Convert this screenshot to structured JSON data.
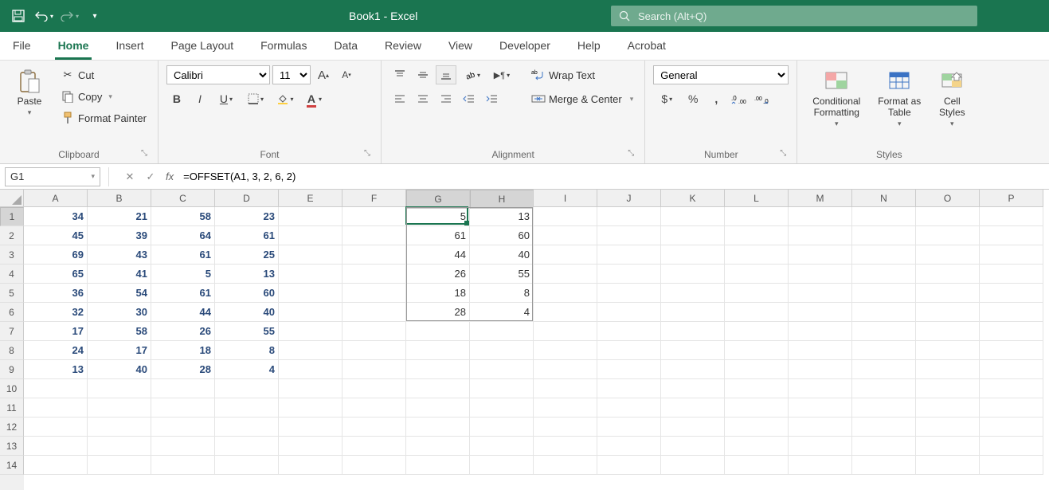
{
  "title": "Book1 - Excel",
  "search": {
    "placeholder": "Search (Alt+Q)"
  },
  "tabs": [
    "File",
    "Home",
    "Insert",
    "Page Layout",
    "Formulas",
    "Data",
    "Review",
    "View",
    "Developer",
    "Help",
    "Acrobat"
  ],
  "activeTab": "Home",
  "ribbon": {
    "clipboard": {
      "paste": "Paste",
      "cut": "Cut",
      "copy": "Copy",
      "fpainter": "Format Painter",
      "label": "Clipboard"
    },
    "font": {
      "name": "Calibri",
      "size": "11",
      "label": "Font"
    },
    "alignment": {
      "wrap": "Wrap Text",
      "merge": "Merge & Center",
      "label": "Alignment"
    },
    "number": {
      "format": "General",
      "label": "Number"
    },
    "styles": {
      "cond": "Conditional Formatting",
      "table": "Format as Table",
      "cell": "Cell Styles",
      "label": "Styles"
    }
  },
  "nameBox": "G1",
  "formula": "=OFFSET(A1, 3, 2, 6, 2)",
  "columns": [
    "A",
    "B",
    "C",
    "D",
    "E",
    "F",
    "G",
    "H",
    "I",
    "J",
    "K",
    "L",
    "M",
    "N",
    "O",
    "P"
  ],
  "rowCount": 14,
  "dataA": [
    [
      34,
      21,
      58,
      23
    ],
    [
      45,
      39,
      64,
      61
    ],
    [
      69,
      43,
      61,
      25
    ],
    [
      65,
      41,
      5,
      13
    ],
    [
      36,
      54,
      61,
      60
    ],
    [
      32,
      30,
      44,
      40
    ],
    [
      17,
      58,
      26,
      55
    ],
    [
      24,
      17,
      18,
      8
    ],
    [
      13,
      40,
      28,
      4
    ]
  ],
  "dataG": [
    [
      5,
      13
    ],
    [
      61,
      60
    ],
    [
      44,
      40
    ],
    [
      26,
      55
    ],
    [
      18,
      8
    ],
    [
      28,
      4
    ]
  ],
  "activeCell": {
    "col": 6,
    "row": 0
  },
  "spillRange": {
    "col": 6,
    "row": 0,
    "w": 2,
    "h": 6
  }
}
